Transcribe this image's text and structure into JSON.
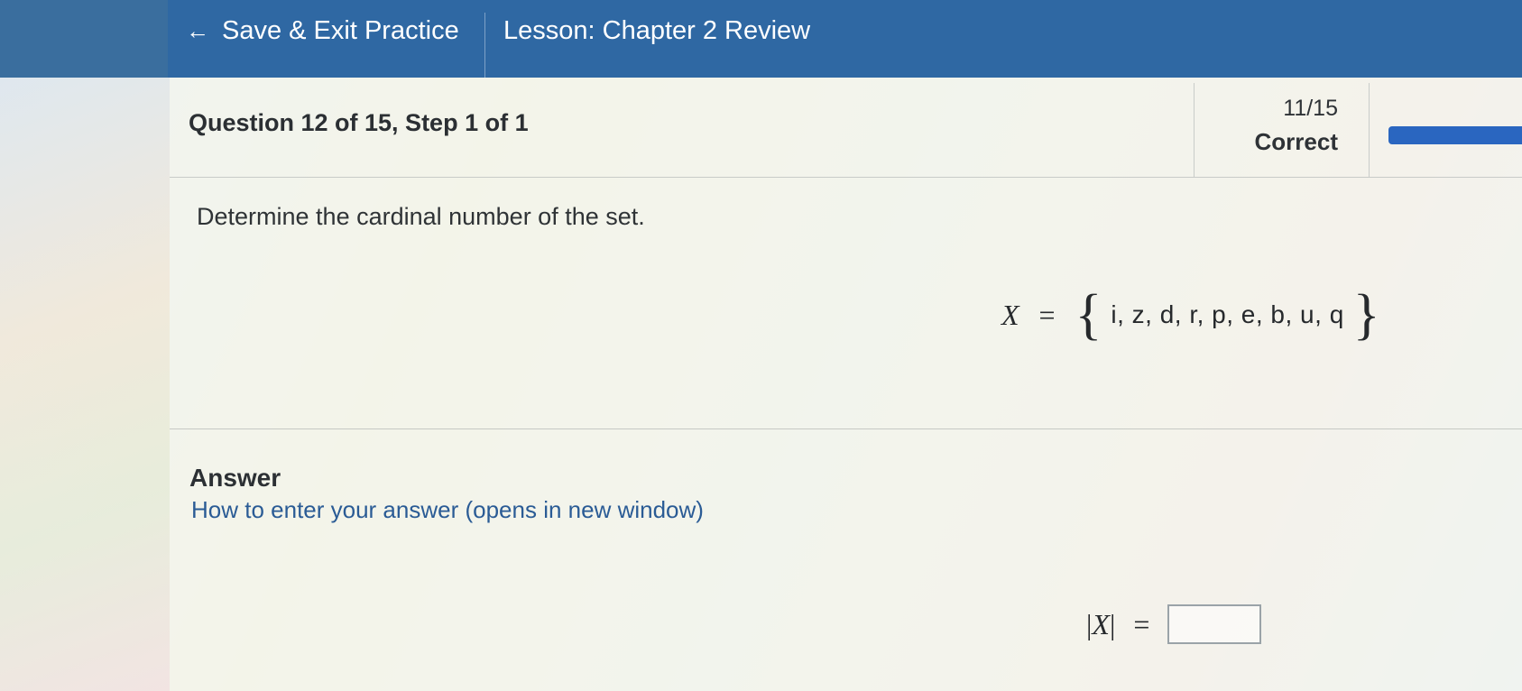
{
  "nav": {
    "back_icon": "←",
    "back_label": "Save & Exit Practice",
    "lesson": "Lesson: Chapter 2 Review"
  },
  "question": {
    "title": "Question 12 of 15, Step 1 of 1",
    "score": "11/15",
    "score_label": "Correct",
    "progress_fraction": 0.73,
    "prompt": "Determine the cardinal number of the set."
  },
  "set": {
    "name": "X",
    "equals": "=",
    "open_brace": "{",
    "elements": "i, z, d, r, p, e, b, u, q",
    "close_brace": "}"
  },
  "answer": {
    "label": "Answer",
    "help_link": "How to enter your answer (opens in new window)",
    "lhs_bar_open": "|",
    "lhs_var": "X",
    "lhs_bar_close": "|",
    "equals": "=",
    "value": ""
  },
  "colors": {
    "header_bar": "#2f68a3",
    "progress": "#2a66c0",
    "link": "#2a5b95"
  }
}
